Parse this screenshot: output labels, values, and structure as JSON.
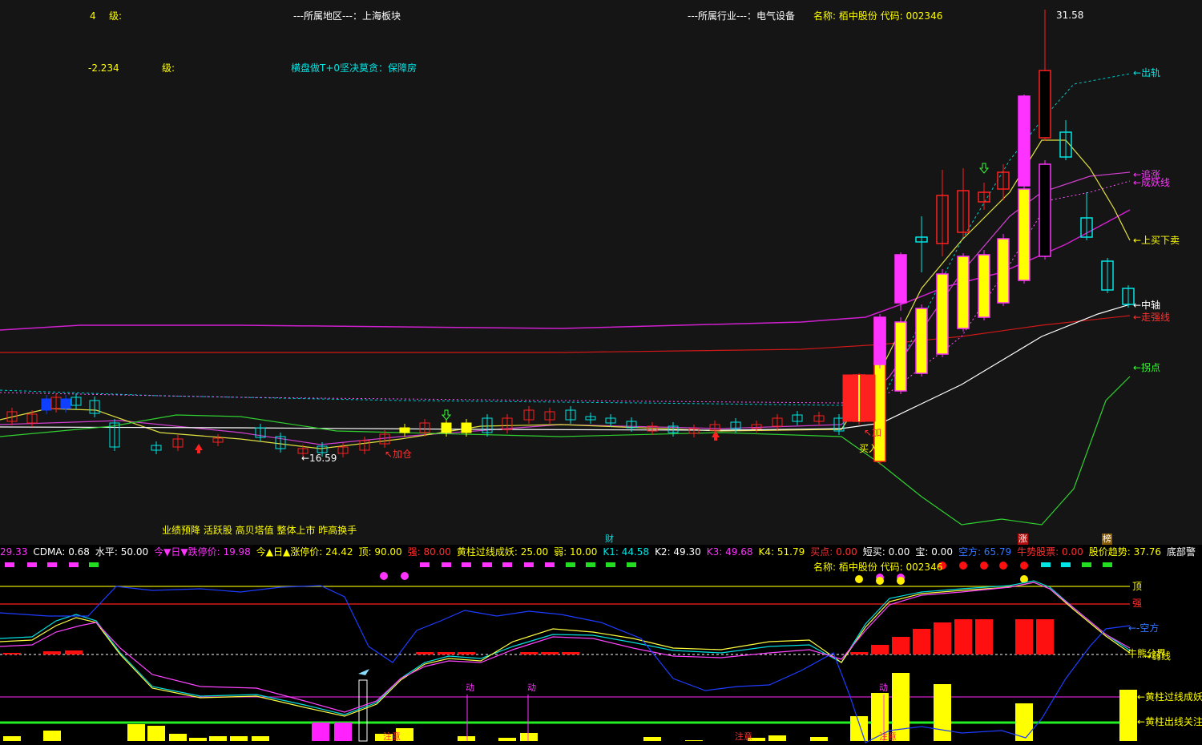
{
  "colors": {
    "yellow": "#ffff00",
    "cyan": "#00e5e5",
    "red": "#ff2020",
    "magenta": "#ff33ff",
    "green": "#33ff33",
    "white": "#ffffff",
    "blue": "#1e3cff"
  },
  "header": {
    "level_value": "4",
    "level_label": "级:",
    "value2": "-2.234",
    "level_label2": "级:",
    "region": "---所属地区---：上海板块",
    "industry": "---所属行业---：电气设备",
    "name_code": "名称: 栢中股份 代码: 002346",
    "slogan": "横盘做T+0坚决莫贪：保障房",
    "tags": "业绩预降 活跃股 高贝塔值 整体上市 昨高换手"
  },
  "price_labels": {
    "high": "31.58",
    "low": "←16.59"
  },
  "signals": {
    "add": "↖加仓",
    "add2": "↖加",
    "buy": "买入"
  },
  "legend": {
    "out_track": "←出轨",
    "chase": "←追涨",
    "demon": "←成妖线",
    "buy_sell": "←上买下卖",
    "mid": "←中轴",
    "strong": "←走强线",
    "turn": "←拐点"
  },
  "markers": {
    "cai": "财",
    "zhang": "涨",
    "bang": "榜"
  },
  "indicator_bar": [
    {
      "text": "29.33",
      "color": "#ff33ff"
    },
    {
      "text": "CDMA: 0.68",
      "color": "#ffffff"
    },
    {
      "text": "水平: 50.00",
      "color": "#ffffff"
    },
    {
      "text": "今▼日▼跌停价: 19.98",
      "color": "#ff33ff"
    },
    {
      "text": "今▲日▲涨停价: 24.42",
      "color": "#ffff00"
    },
    {
      "text": "顶: 90.00",
      "color": "#ffff00"
    },
    {
      "text": "强: 80.00",
      "color": "#ff3030"
    },
    {
      "text": "黄柱过线成妖: 25.00",
      "color": "#ffff00"
    },
    {
      "text": "弱: 10.00",
      "color": "#ffff00"
    },
    {
      "text": "K1: 44.58",
      "color": "#00e5e5"
    },
    {
      "text": "K2: 49.30",
      "color": "#ffffff"
    },
    {
      "text": "K3: 49.68",
      "color": "#ff33ff"
    },
    {
      "text": "K4: 51.79",
      "color": "#ffff00"
    },
    {
      "text": "买点: 0.00",
      "color": "#ff3030"
    },
    {
      "text": "短买: 0.00",
      "color": "#ffffff"
    },
    {
      "text": "宝: 0.00",
      "color": "#ffffff"
    },
    {
      "text": "空方: 65.79",
      "color": "#3377ff"
    },
    {
      "text": "牛势股票: 0.00",
      "color": "#ff3030"
    },
    {
      "text": "股价趋势: 37.76",
      "color": "#ffff00"
    },
    {
      "text": "底部警",
      "color": "#ffffff"
    }
  ],
  "sub": {
    "name_code": "名称: 栢中股份 代码: 002346",
    "ding": "顶",
    "qiang": "强",
    "kongfang": "←-空方",
    "niushi": "牛熊分界",
    "ruo": "→弱线",
    "yaoline": "←黄柱过线成妖",
    "guanzhu": "←黄柱出线关注",
    "dong": "动",
    "zhuyi": "注意"
  }
}
